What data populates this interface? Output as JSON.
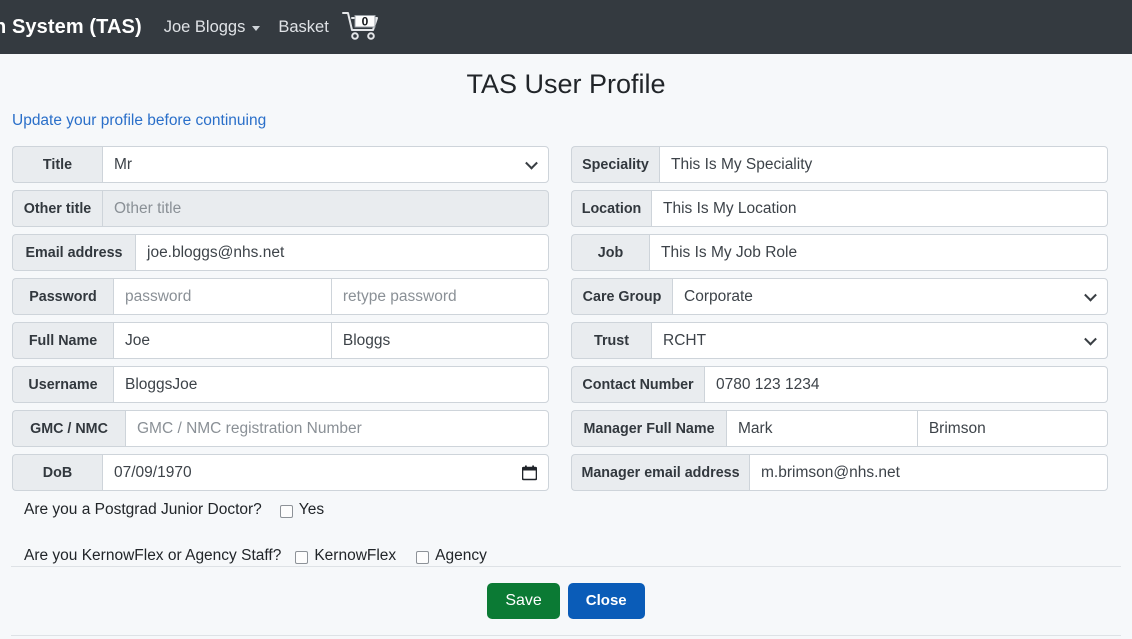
{
  "navbar": {
    "brand": "n System (TAS)",
    "user_menu": "Joe Bloggs",
    "basket_label": "Basket",
    "basket_count": "0",
    "bg_color": "#343a40"
  },
  "header": {
    "title": "TAS User Profile",
    "subtitle": "Update your profile before continuing",
    "subtitle_color": "#2a6fc9"
  },
  "form": {
    "left": {
      "title": {
        "label": "Title",
        "value": "Mr",
        "type": "select"
      },
      "other_title": {
        "label": "Other title",
        "placeholder": "Other title",
        "value": "",
        "disabled": true
      },
      "email": {
        "label": "Email address",
        "value": "joe.bloggs@nhs.net"
      },
      "password": {
        "label": "Password",
        "placeholder": "password",
        "retype_placeholder": "retype password",
        "value": "",
        "retype_value": ""
      },
      "full_name": {
        "label": "Full Name",
        "first": "Joe",
        "last": "Bloggs"
      },
      "username": {
        "label": "Username",
        "value": "BloggsJoe"
      },
      "gmc_nmc": {
        "label": "GMC / NMC",
        "placeholder": "GMC / NMC registration Number",
        "value": ""
      },
      "dob": {
        "label": "DoB",
        "value": "07/09/1970",
        "type": "date"
      }
    },
    "right": {
      "speciality": {
        "label": "Speciality",
        "value": "This Is My Speciality"
      },
      "location": {
        "label": "Location",
        "value": "This Is My Location"
      },
      "job": {
        "label": "Job",
        "value": "This Is My Job Role"
      },
      "care_group": {
        "label": "Care Group",
        "value": "Corporate",
        "type": "select"
      },
      "trust": {
        "label": "Trust",
        "value": "RCHT",
        "type": "select"
      },
      "contact_number": {
        "label": "Contact Number",
        "value": "0780 123 1234"
      },
      "manager_full_name": {
        "label": "Manager Full Name",
        "first": "Mark",
        "last": "Brimson"
      },
      "manager_email": {
        "label": "Manager email address",
        "value": "m.brimson@nhs.net"
      }
    }
  },
  "checkboxes": {
    "postgrad": {
      "question": "Are you a Postgrad Junior Doctor?",
      "option_yes": "Yes",
      "checked": false
    },
    "staff_type": {
      "question": "Are you KernowFlex or Agency Staff?",
      "option_kernowflex": "KernowFlex",
      "option_agency": "Agency",
      "kernowflex_checked": false,
      "agency_checked": false
    }
  },
  "footer": {
    "save_label": "Save",
    "close_label": "Close",
    "save_color": "#0b7a34",
    "close_color": "#0a5cb8"
  }
}
